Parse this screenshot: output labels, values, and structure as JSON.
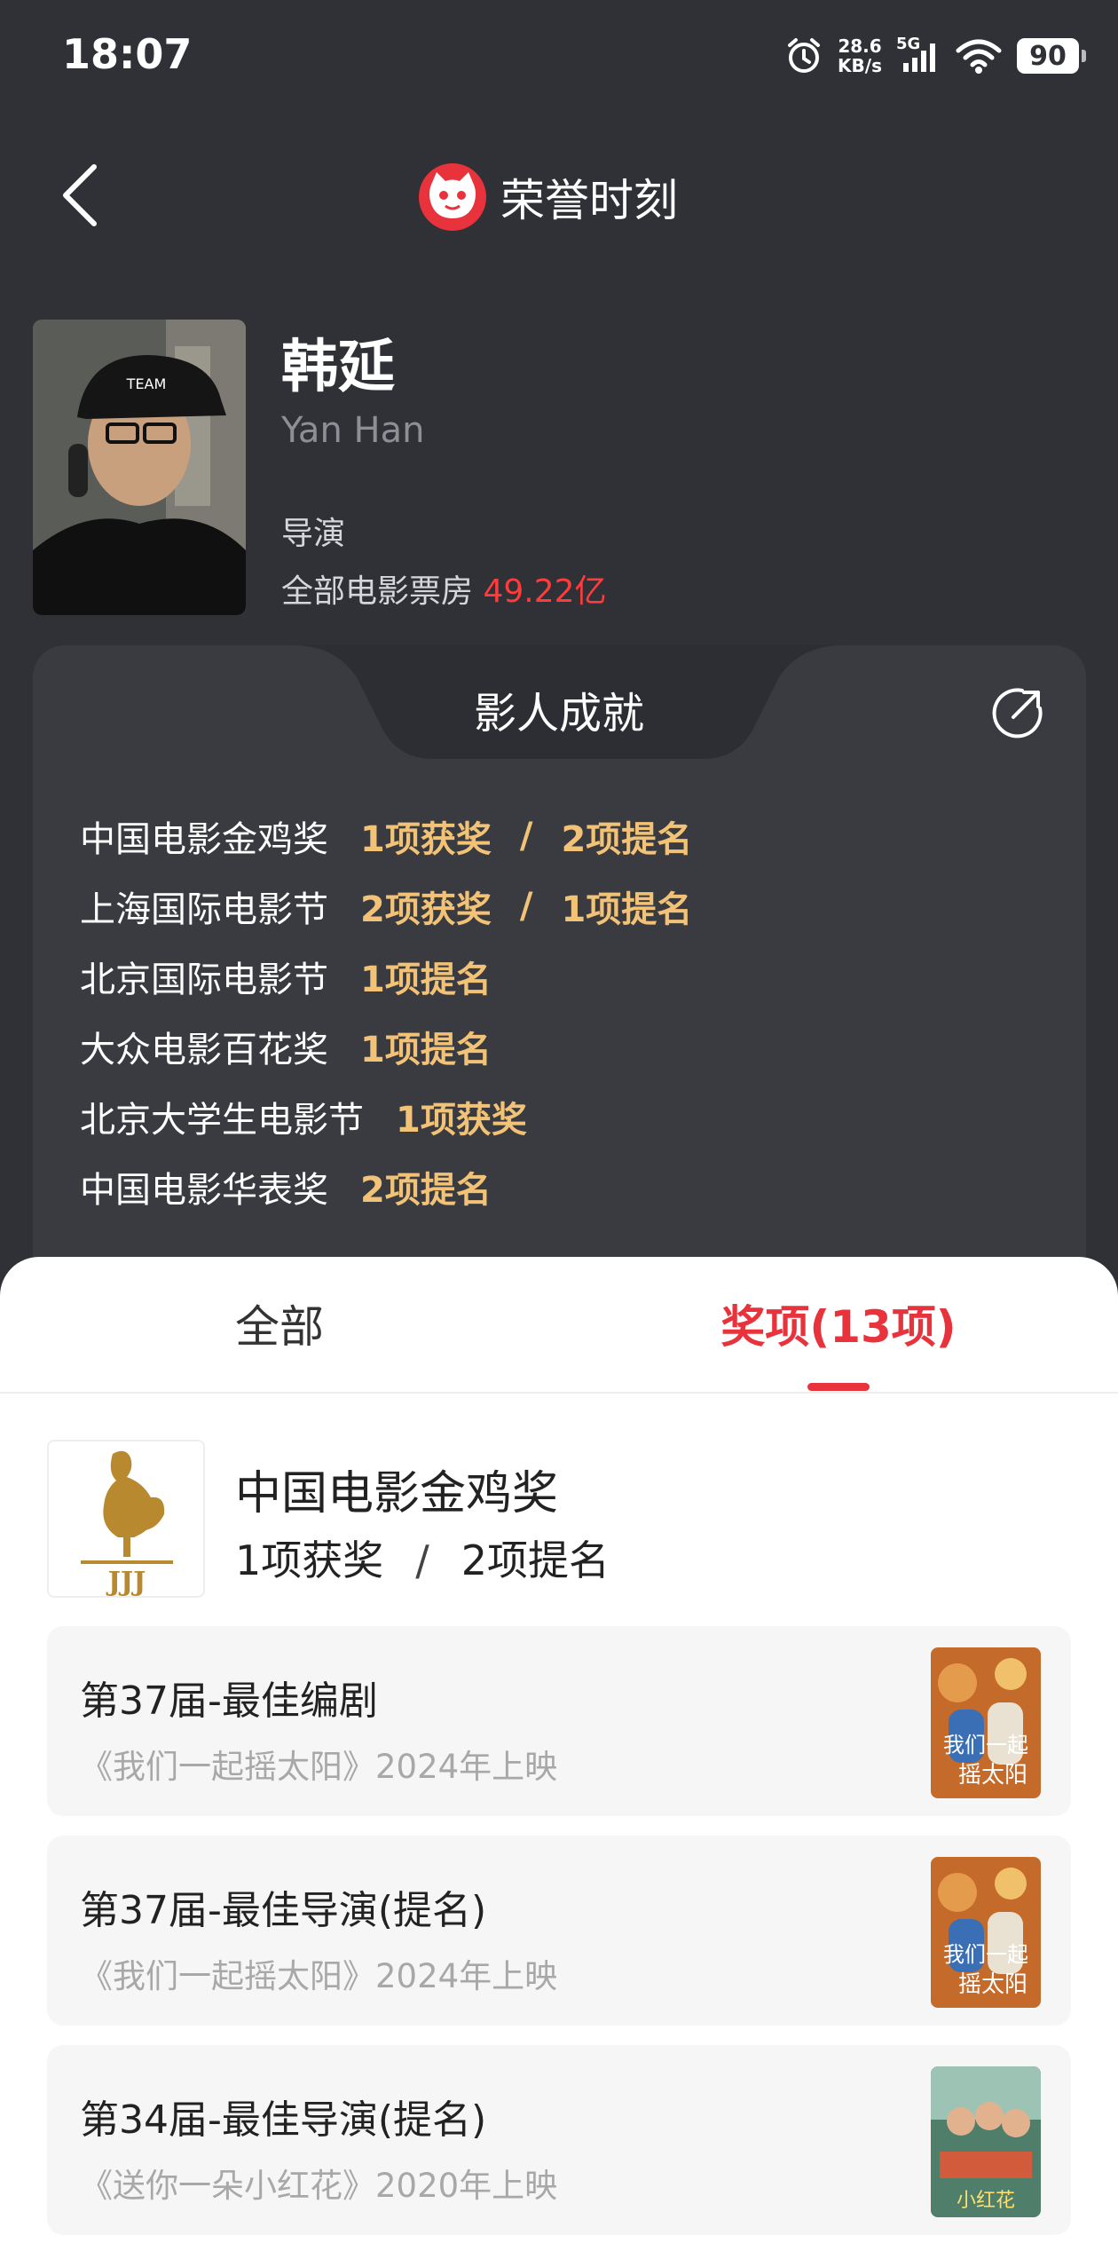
{
  "status": {
    "time": "18:07",
    "speed_value": "28.6",
    "speed_unit": "KB/s",
    "network": "5G",
    "battery": "90"
  },
  "header": {
    "title": "荣誉时刻"
  },
  "person": {
    "name": "韩延",
    "en_name": "Yan Han",
    "role": "导演",
    "box_office_label": "全部电影票房",
    "box_office_value": "49.22亿"
  },
  "achievements": {
    "title": "影人成就",
    "rows": [
      {
        "name": "中国电影金鸡奖",
        "wins": "1项获奖",
        "sep": "/",
        "noms": "2项提名"
      },
      {
        "name": "上海国际电影节",
        "wins": "2项获奖",
        "sep": "/",
        "noms": "1项提名"
      },
      {
        "name": "北京国际电影节",
        "wins": "1项提名"
      },
      {
        "name": "大众电影百花奖",
        "wins": "1项提名"
      },
      {
        "name": "北京大学生电影节",
        "wins": "1项获奖"
      },
      {
        "name": "中国电影华表奖",
        "wins": "2项提名"
      }
    ]
  },
  "tabs": {
    "all": "全部",
    "awards": "奖项(13项)"
  },
  "festival": {
    "name": "中国电影金鸡奖",
    "wins": "1项获奖",
    "sep": "/",
    "noms": "2项提名",
    "logo_text": "JJJ"
  },
  "awards": [
    {
      "title": "第37届-最佳编剧",
      "film": "《我们一起摇太阳》2024年上映"
    },
    {
      "title": "第37届-最佳导演(提名)",
      "film": "《我们一起摇太阳》2024年上映"
    },
    {
      "title": "第34届-最佳导演(提名)",
      "film": "《送你一朵小红花》2020年上映"
    }
  ],
  "colors": {
    "accent": "#e8323c",
    "gold": "#f2c277",
    "box_office": "#ff3b3b",
    "dark_bg": "#2f3137"
  }
}
